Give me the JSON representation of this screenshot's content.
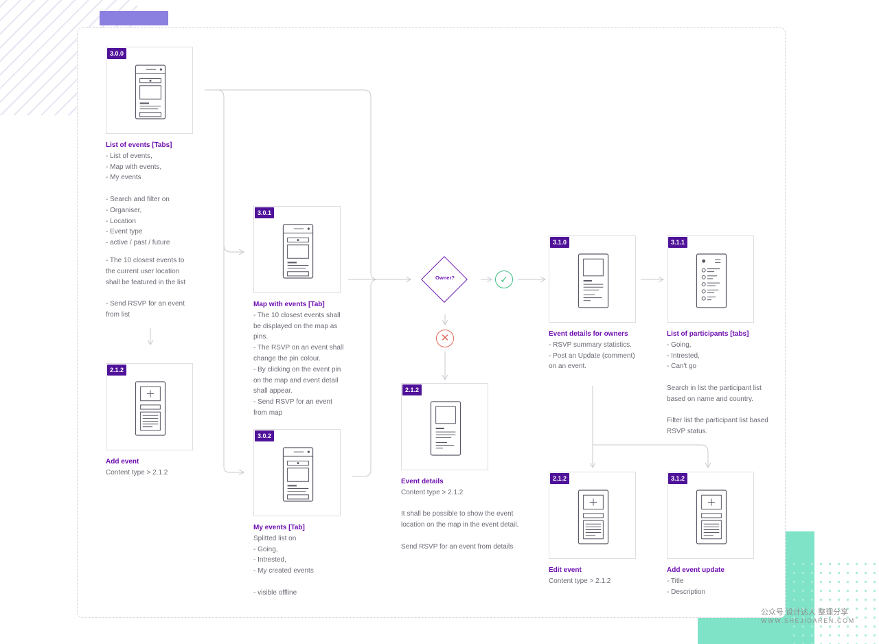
{
  "screens": [
    {
      "id": "3.0.0",
      "title": "List of events [Tabs]",
      "lines": [
        "- List of events,",
        "- Map with events,",
        "- My events",
        "",
        "- Search and filter on",
        "- Organiser,",
        "- Location",
        "- Event type",
        "- active / past / future",
        "",
        "- The 10 closest events to",
        "the current user location",
        "shall be featured in the list",
        "",
        "- Send RSVP for an event",
        "from list"
      ]
    },
    {
      "id": "2.1.2",
      "title": "Add event",
      "lines": [
        "Content type > 2.1.2"
      ]
    },
    {
      "id": "3.0.1",
      "title": "Map with events [Tab]",
      "lines": [
        "- The 10 closest events shall",
        "be displayed on the map as",
        "pins.",
        "- The RSVP on an event shall",
        "change the pin colour.",
        "- By clicking on the event pin",
        "on the map and event detail",
        "shall appear.",
        "- Send RSVP for an event",
        "from map"
      ]
    },
    {
      "id": "3.0.2",
      "title": "My events [Tab]",
      "lines": [
        "Splitted list on",
        "- Going,",
        "- Intrested,",
        "- My created events",
        "",
        "- visible offline"
      ]
    },
    {
      "id": "2.1.2",
      "title": "Event details",
      "lines": [
        "Content type > 2.1.2",
        "",
        "It shall be possible to show the event",
        "location on the map in the event detail.",
        "",
        "Send RSVP for an event from details"
      ]
    },
    {
      "id": "3.1.0",
      "title": "Event details for owners",
      "lines": [
        "- RSVP summary statistics.",
        "- Post an Update (comment)",
        "on an event."
      ]
    },
    {
      "id": "3.1.1",
      "title": "List of participants [tabs]",
      "lines": [
        "- Going,",
        "- Intrested,",
        "- Can't go",
        "",
        "Search in list the participant list",
        "based on name and country.",
        "",
        "Filter list the participant list based",
        "RSVP status."
      ]
    },
    {
      "id": "2.1.2",
      "title": "Edit event",
      "lines": [
        "Content type > 2.1.2"
      ]
    },
    {
      "id": "3.1.2",
      "title": "Add event update",
      "lines": [
        "- Title",
        "- Description"
      ]
    }
  ],
  "decision": {
    "label": "Owner?"
  },
  "icons": {
    "yes": "check-icon",
    "no": "cross-icon"
  },
  "watermark": {
    "line1": "公众号 设计达人 整理分享",
    "line2": "WWW.SHEJIDAREN.COM"
  },
  "colors": {
    "accent": "#6d0fb0",
    "badge": "#4f1299",
    "connector": "#c9c9cf",
    "yes": "#3dc080",
    "no": "#e06a5a",
    "decoration": "#7fe3c8"
  }
}
